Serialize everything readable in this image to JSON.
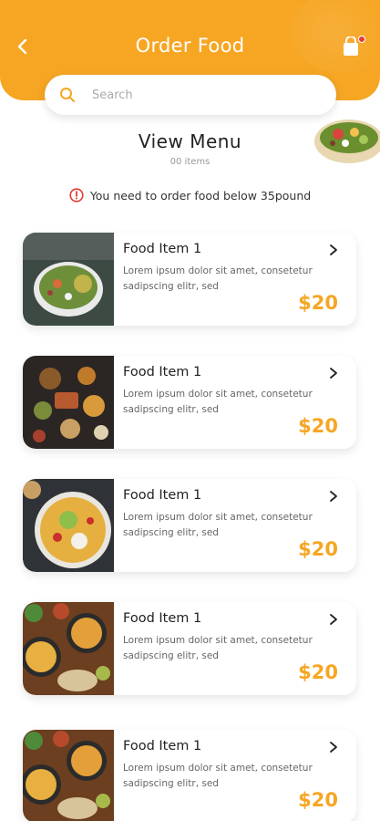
{
  "header": {
    "title": "Order Food",
    "accent_color": "#F6A623",
    "back_icon": "chevron-left-icon",
    "cart_icon": "shopping-bag-icon"
  },
  "search": {
    "placeholder": "Search",
    "value": ""
  },
  "menu": {
    "heading": "View Menu",
    "count": "00 items",
    "notice": "You need to order food below 35pound"
  },
  "items": [
    {
      "name": "Food Item 1",
      "description": "Lorem ipsum dolor sit amet, consetetur sadipscing elitr, sed",
      "price": "$20",
      "image": "salad-bowl"
    },
    {
      "name": "Food Item 1",
      "description": "Lorem ipsum dolor sit amet, consetetur sadipscing elitr, sed",
      "price": "$20",
      "image": "table-spread"
    },
    {
      "name": "Food Item 1",
      "description": "Lorem ipsum dolor sit amet, consetetur sadipscing elitr, sed",
      "price": "$20",
      "image": "nachos"
    },
    {
      "name": "Food Item 1",
      "description": "Lorem ipsum dolor sit amet, consetetur sadipscing elitr, sed",
      "price": "$20",
      "image": "rice-dishes"
    },
    {
      "name": "Food Item 1",
      "description": "Lorem ipsum dolor sit amet, consetetur sadipscing elitr, sed",
      "price": "$20",
      "image": "rice-dishes"
    }
  ]
}
